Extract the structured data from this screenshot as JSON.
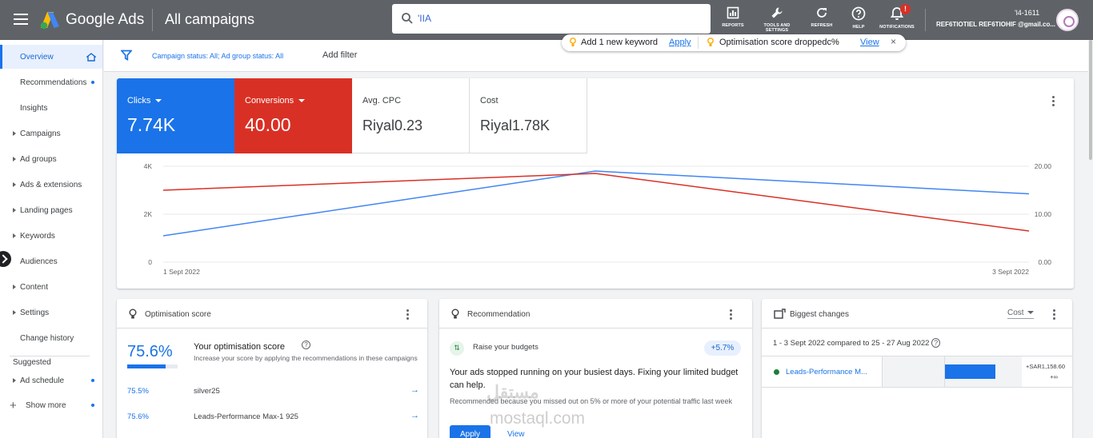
{
  "header": {
    "brand": "Google Ads",
    "page_title": "All campaigns",
    "search_value": "'IIA",
    "tools": [
      {
        "label": "REPORTS",
        "icon": "reports-icon"
      },
      {
        "label": "TOOLS AND SETTINGS",
        "icon": "wrench-icon"
      },
      {
        "label": "REFRESH",
        "icon": "refresh-icon"
      },
      {
        "label": "HELP",
        "icon": "help-icon"
      },
      {
        "label": "NOTIFICATIONS",
        "icon": "bell-icon"
      }
    ],
    "notification_badge": "!",
    "account_id": "'l4-1611",
    "account_email": "REF6TIOTIEL REF6TIOHIF @gmail.co..."
  },
  "sidebar": {
    "items": [
      {
        "label": "Overview",
        "active": true
      },
      {
        "label": "Recommendations",
        "dot": true
      },
      {
        "label": "Insights"
      },
      {
        "label": "Campaigns",
        "caret": true
      },
      {
        "label": "Ad groups",
        "caret": true
      },
      {
        "label": "Ads & extensions",
        "caret": true
      },
      {
        "label": "Landing pages",
        "caret": true
      },
      {
        "label": "Keywords",
        "caret": true
      },
      {
        "label": "Audiences"
      },
      {
        "label": "Content",
        "caret": true
      },
      {
        "label": "Settings",
        "caret": true
      },
      {
        "label": "Change history"
      }
    ],
    "suggested_label": "Suggested",
    "ad_schedule": "Ad schedule",
    "show_more": "Show more"
  },
  "filterbar": {
    "status_text": "Campaign status: All; Ad group status: All",
    "add_filter": "Add filter"
  },
  "notification_pill": {
    "msg1": "Add 1 new keyword",
    "action1": "Apply",
    "msg2": "Optimisation score droppedc%",
    "action2": "View",
    "close": "×"
  },
  "metrics": [
    {
      "label": "Clicks",
      "value": "7.74K",
      "color": "#1a73e8"
    },
    {
      "label": "Conversions",
      "value": "40.00",
      "color": "#d93025"
    },
    {
      "label": "Avg. CPC",
      "value": "Riyal0.23"
    },
    {
      "label": "Cost",
      "value": "Riyal1.78K"
    }
  ],
  "chart_data": {
    "type": "line",
    "x": [
      "1 Sept 2022",
      "2 Sept 2022",
      "3 Sept 2022"
    ],
    "x_tick_labels": [
      "1 Sept 2022",
      "3 Sept 2022"
    ],
    "left_axis": {
      "ticks": [
        "0",
        "2K",
        "4K"
      ],
      "ylim": [
        0,
        4000
      ]
    },
    "right_axis": {
      "ticks": [
        "0.00",
        "10.00",
        "20.00"
      ],
      "ylim": [
        0,
        20
      ]
    },
    "series": [
      {
        "name": "Clicks",
        "axis": "left",
        "color": "#4285f4",
        "values": [
          1100,
          3800,
          2850
        ]
      },
      {
        "name": "Conversions",
        "axis": "right",
        "color": "#d93025",
        "values": [
          15,
          18.5,
          6.5
        ]
      }
    ]
  },
  "optimisation_card": {
    "title": "Optimisation score",
    "score": "75.6%",
    "score_fraction": 0.756,
    "heading": "Your optimisation score",
    "description": "Increase your score by applying the recommendations in these campaigns",
    "rows": [
      {
        "pct": "75.5%",
        "name": "silver25"
      },
      {
        "pct": "75.6%",
        "name": "Leads-Performance Max-1 925"
      }
    ]
  },
  "recommendation_card": {
    "title": "Recommendation",
    "name": "Raise your budgets",
    "badge": "+5.7%",
    "text": "Your ads stopped running on your busiest days. Fixing your limited budget can help.",
    "sub": "Recommended because you missed out on 5% or more of your potential traffic last week",
    "apply": "Apply",
    "view": "View"
  },
  "biggest_changes_card": {
    "title": "Biggest changes",
    "metric_select": "Cost",
    "range": "1 - 3 Sept 2022 compared to 25 - 27 Aug 2022",
    "row_name": "Leads-Performance M...",
    "row_value": "+SAR1,158.60",
    "row_value2": "+∞"
  },
  "watermark": {
    "arabic": "مستقل",
    "latin": "mostaql.com"
  }
}
